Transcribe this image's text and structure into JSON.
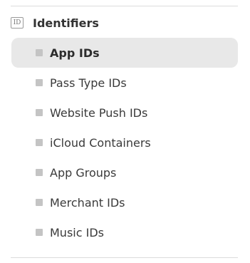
{
  "section": {
    "icon": "id-badge-icon",
    "icon_text": "ID",
    "title": "Identifiers"
  },
  "nav": {
    "active_index": 0,
    "items": [
      {
        "label": "App IDs"
      },
      {
        "label": "Pass Type IDs"
      },
      {
        "label": "Website Push IDs"
      },
      {
        "label": "iCloud Containers"
      },
      {
        "label": "App Groups"
      },
      {
        "label": "Merchant IDs"
      },
      {
        "label": "Music IDs"
      }
    ]
  },
  "colors": {
    "active_background": "#e8e8e8",
    "bullet": "#c4c4c4",
    "divider": "#dcdcdc",
    "text": "#333333"
  }
}
